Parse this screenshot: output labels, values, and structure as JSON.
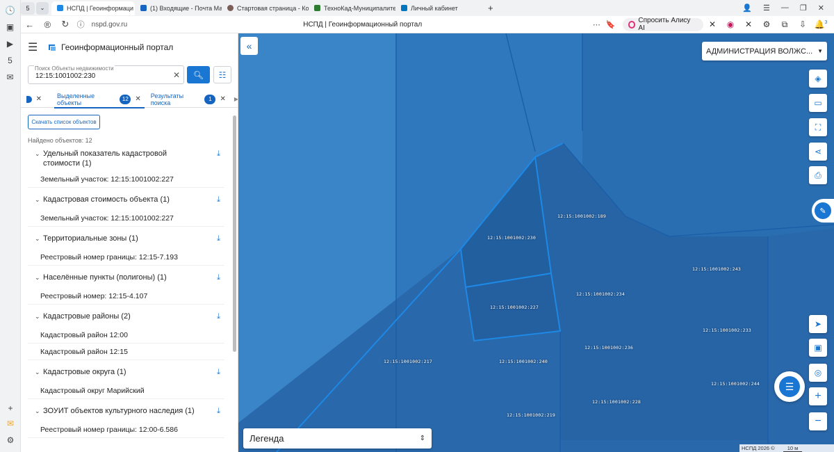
{
  "browser": {
    "tab_count": "5",
    "tabs": [
      {
        "label": "НСПД | Геоинформаци",
        "active": true,
        "color": "#1e88e5"
      },
      {
        "label": "(1) Входящие - Почта Ма",
        "active": false,
        "color": "#1565c0"
      },
      {
        "label": "Стартовая страница - Ко",
        "active": false,
        "color": "#7b5e57"
      },
      {
        "label": "ТехноКад-Муниципалите",
        "active": false,
        "color": "#2e7d32"
      },
      {
        "label": "Личный кабинет",
        "active": false,
        "color": "#0277bd"
      }
    ],
    "url": "nspd.gov.ru",
    "page_title": "НСПД | Геоинформационный портал",
    "alice_label": "Спросить Алису AI",
    "notif_count": "3"
  },
  "panel": {
    "title": "Геоинформационный портал",
    "search": {
      "placeholder": "Поиск Объекты недвижимости",
      "value": "12:15:1001002:230"
    },
    "tabs": {
      "selected_label": "Выделенные объекты",
      "selected_count": "12",
      "results_label": "Результаты поиска",
      "results_count": "1"
    },
    "download_list_label": "Скачать список объектов",
    "found_text": "Найдено объектов: 12",
    "groups": [
      {
        "title": "Удельный показатель кадастровой стоимости (1)",
        "items": [
          "Земельный участок: 12:15:1001002:227"
        ]
      },
      {
        "title": "Кадастровая стоимость объекта (1)",
        "items": [
          "Земельный участок: 12:15:1001002:227"
        ]
      },
      {
        "title": "Территориальные зоны (1)",
        "items": [
          "Реестровый номер границы: 12:15-7.193"
        ]
      },
      {
        "title": "Населённые пункты (полигоны) (1)",
        "items": [
          "Реестровый номер: 12:15-4.107"
        ]
      },
      {
        "title": "Кадастровые районы (2)",
        "items": [
          "Кадастровый район 12:00",
          "Кадастровый район 12:15"
        ]
      },
      {
        "title": "Кадастровые округа (1)",
        "items": [
          "Кадастровый округ Марийский"
        ]
      },
      {
        "title": "ЗОУИТ объектов культурного наследия (1)",
        "items": [
          "Реестровый номер границы: 12:00-6.586"
        ]
      }
    ]
  },
  "map": {
    "admin_select": "АДМИНИСТРАЦИЯ ВОЛЖС...",
    "legend_label": "Легенда",
    "attribution": "НСПД 2026 ©",
    "scale": "10 м",
    "parcel_labels": [
      "12:15:1001002:189",
      "12:15:1001002:230",
      "12:15:1001002:243",
      "12:15:1001002:227",
      "12:15:1001002:234",
      "12:15:1001002:233",
      "12:15:1001002:217",
      "12:15:1001002:240",
      "12:15:1001002:236",
      "12:15:1001002:244",
      "12:15:1001002:228",
      "12:15:1001002:219"
    ]
  }
}
